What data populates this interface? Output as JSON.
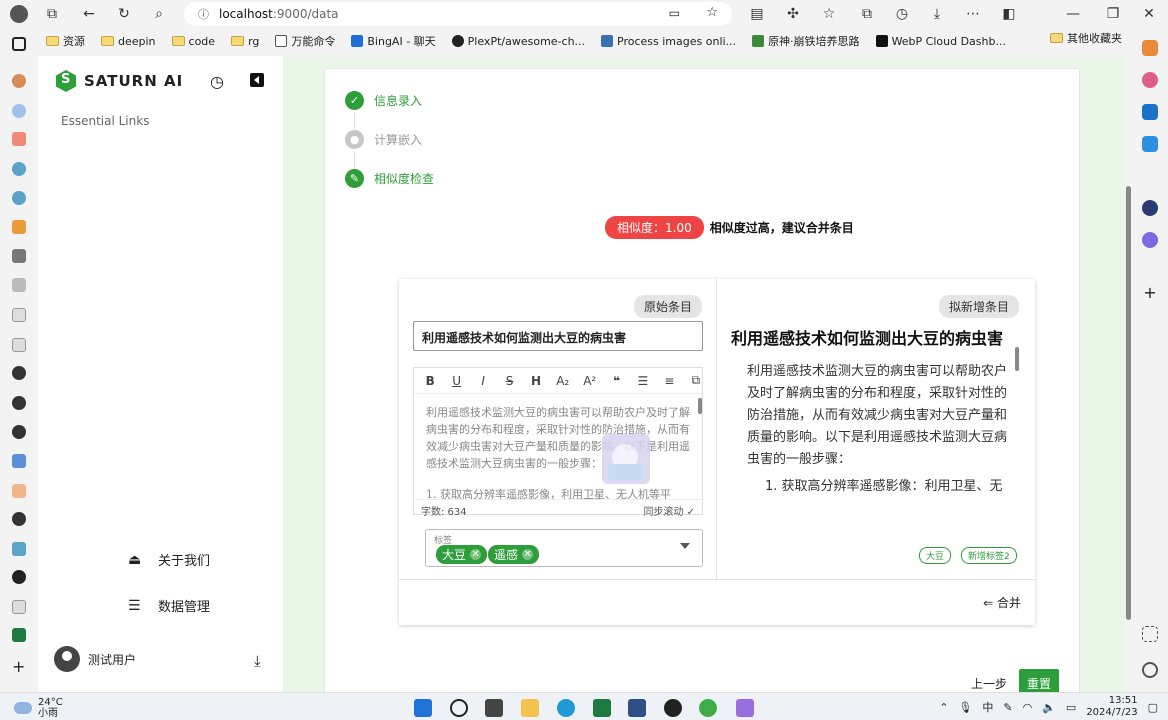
{
  "browser": {
    "url_host": "localhost",
    "url_path": ":9000/data",
    "bookmarks": [
      {
        "label": "资源",
        "kind": "folder"
      },
      {
        "label": "deepin",
        "kind": "folder"
      },
      {
        "label": "code",
        "kind": "folder"
      },
      {
        "label": "rg",
        "kind": "folder"
      },
      {
        "label": "万能命令",
        "kind": "page"
      },
      {
        "label": "BingAI - 聊天",
        "kind": "page"
      },
      {
        "label": "PlexPt/awesome-ch...",
        "kind": "page"
      },
      {
        "label": "Process images onli...",
        "kind": "page"
      },
      {
        "label": "原神·崩铁培养思路",
        "kind": "page"
      },
      {
        "label": "WebP Cloud Dashb...",
        "kind": "page"
      }
    ],
    "other_bookmarks": "其他收藏夹"
  },
  "sidebar": {
    "brand": "SATURN AI",
    "essential_links": "Essential Links",
    "about": "关于我们",
    "data_mgmt": "数据管理",
    "user": "测试用户"
  },
  "steps": [
    {
      "label": "信息录入",
      "state": "done"
    },
    {
      "label": "计算嵌入",
      "state": "todo"
    },
    {
      "label": "相似度检查",
      "state": "done"
    }
  ],
  "similarity": {
    "badge": "相似度：1.00",
    "message": "相似度过高，建议合并条目"
  },
  "original": {
    "header": "原始条目",
    "title": "利用遥感技术如何监测出大豆的病虫害",
    "body": "利用遥感技术监测大豆的病虫害可以帮助农户及时了解病虫害的分布和程度，采取针对性的防治措施，从而有效减少病虫害对大豆产量和质量的影响。以下是利用遥感技术监测大豆病虫害的一般步骤：",
    "list_item": "1. 获取高分辨率遥感影像，利用卫星、无人机等平",
    "word_count": "字数: 634",
    "sync_scroll": "同步滚动 ✓",
    "tag_label": "标签",
    "tags": [
      "大豆",
      "遥感"
    ]
  },
  "proposed": {
    "header": "拟新增条目",
    "title": "利用遥感技术如何监测出大豆的病虫害",
    "body": "利用遥感技术监测大豆的病虫害可以帮助农户及时了解病虫害的分布和程度，采取针对性的防治措施，从而有效减少病虫害对大豆产量和质量的影响。以下是利用遥感技术监测大豆病虫害的一般步骤：",
    "list_item": "1. 获取高分辨率遥感影像：利用卫星、无",
    "tags": [
      "大豆",
      "新增标签2"
    ]
  },
  "actions": {
    "merge": "⇐ 合并",
    "prev": "上一步",
    "reset": "重置"
  },
  "taskbar": {
    "temp": "24°C",
    "weather": "小雨",
    "ime": "中",
    "time": "13:51",
    "date": "2024/7/23"
  },
  "colors": {
    "accent": "#2e9e3a",
    "danger": "#ef4444",
    "main_bg": "#eaf7e8"
  }
}
